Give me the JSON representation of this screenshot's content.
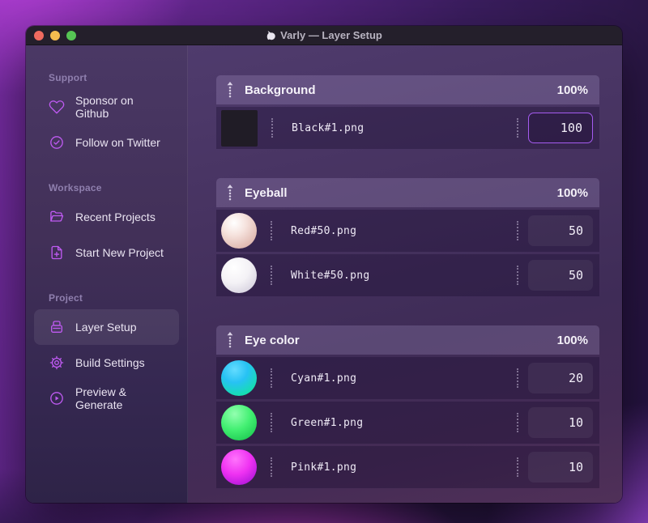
{
  "window": {
    "title": "Varly — Layer Setup",
    "app_icon": "unicorn-icon",
    "traffic_lights": [
      "close",
      "minimize",
      "zoom"
    ]
  },
  "sidebar": {
    "sections": [
      {
        "label": "Support",
        "items": [
          {
            "icon": "heart-icon",
            "label": "Sponsor on Github"
          },
          {
            "icon": "check-badge-icon",
            "label": "Follow on Twitter"
          }
        ]
      },
      {
        "label": "Workspace",
        "items": [
          {
            "icon": "folder-icon",
            "label": "Recent Projects"
          },
          {
            "icon": "file-plus-icon",
            "label": "Start New Project"
          }
        ]
      },
      {
        "label": "Project",
        "items": [
          {
            "icon": "layers-box-icon",
            "label": "Layer Setup",
            "active": true
          },
          {
            "icon": "gear-icon",
            "label": "Build Settings"
          },
          {
            "icon": "play-circle-icon",
            "label": "Preview & Generate"
          }
        ]
      }
    ]
  },
  "layers": {
    "groups": [
      {
        "name": "Background",
        "weight": "100%",
        "rows": [
          {
            "thumb": "black-swatch",
            "file": "Black#1.png",
            "value": "100",
            "focused": true
          }
        ]
      },
      {
        "name": "Eyeball",
        "weight": "100%",
        "rows": [
          {
            "thumb": "red-ball",
            "file": "Red#50.png",
            "value": "50"
          },
          {
            "thumb": "white-ball",
            "file": "White#50.png",
            "value": "50"
          }
        ]
      },
      {
        "name": "Eye color",
        "weight": "100%",
        "rows": [
          {
            "thumb": "cyan-ball",
            "file": "Cyan#1.png",
            "value": "20"
          },
          {
            "thumb": "green-ball",
            "file": "Green#1.png",
            "value": "10"
          },
          {
            "thumb": "pink-ball",
            "file": "Pink#1.png",
            "value": "10"
          }
        ]
      }
    ]
  },
  "colors": {
    "accent_purple": "#bf5af2",
    "focus_border": "#a55bf0",
    "traffic_red": "#ee6a5f",
    "traffic_yellow": "#f5bd4f",
    "traffic_green": "#56c454",
    "titlebar_bg": "#241f2b",
    "ball_red": "#e4c0b8",
    "ball_white": "#f4f2f6",
    "ball_cyan": "#27c2f4",
    "ball_green": "#44f073",
    "ball_pink": "#ef32f2",
    "swatch_black": "#201c26"
  }
}
